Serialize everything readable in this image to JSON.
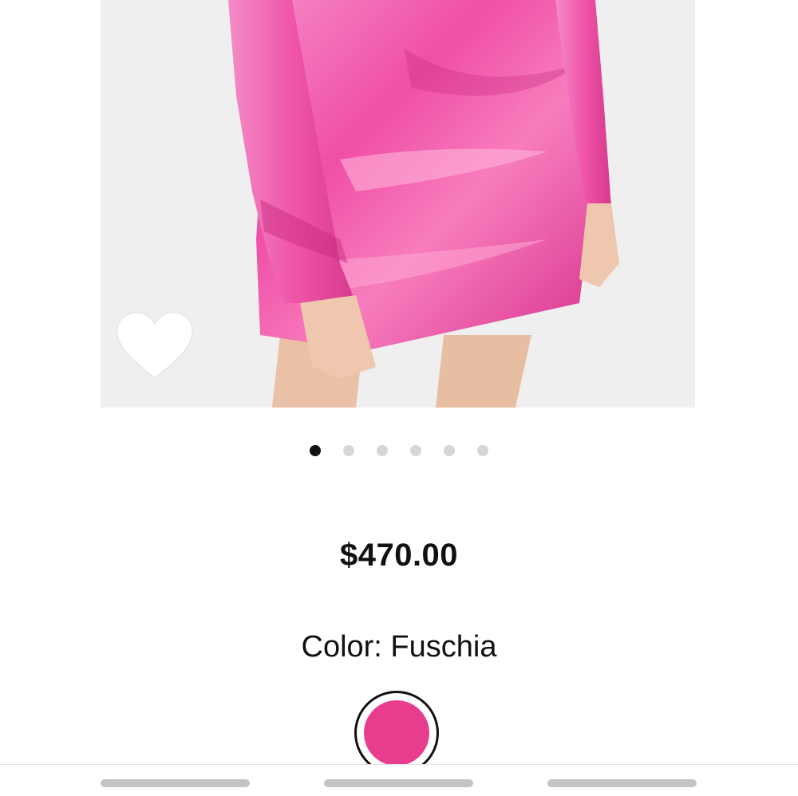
{
  "product": {
    "image_alt": "Pink satin mini dress",
    "price": "$470.00",
    "color_label": "Color: Fuschia",
    "swatch_color": "#e83c8f",
    "favorite_icon": "heart-icon"
  },
  "carousel": {
    "total": 6,
    "active_index": 0
  },
  "colors": {
    "dress": "#f04fa6",
    "dress_shadow": "#c8287d",
    "skin": "#eec7ae",
    "background": "#efefef"
  }
}
